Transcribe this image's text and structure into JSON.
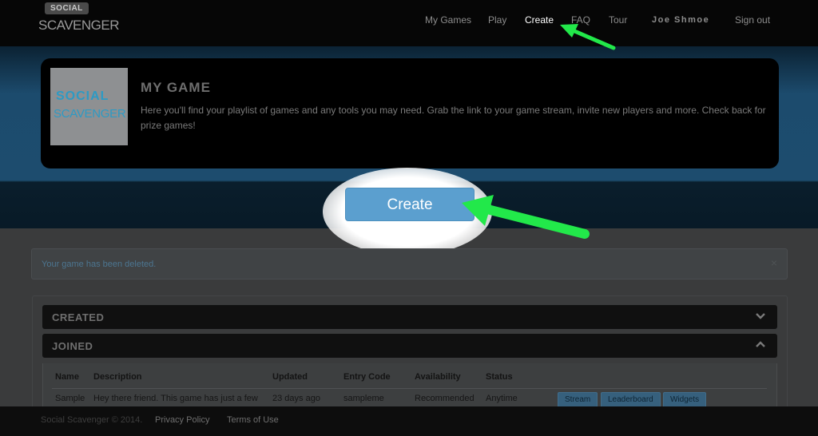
{
  "brand": {
    "badge": "SOCIAL",
    "wordmark": "SCAVENGER"
  },
  "nav": {
    "my_games": "My Games",
    "play": "Play",
    "create": "Create",
    "faq": "FAQ",
    "tour": "Tour",
    "user": "Joe Shmoe",
    "sign_out": "Sign out"
  },
  "hero": {
    "thumb_line1": "SOCIAL",
    "thumb_line2": "SCAVENGER",
    "title": "MY GAME",
    "description": "Here you'll find your playlist of games and any tools you may need. Grab the link to your game stream, invite new players and more. Check back for prize games!"
  },
  "create_button": "Create",
  "alert": {
    "message": "Your game has been deleted.",
    "close": "×"
  },
  "sections": {
    "created": {
      "label": "CREATED",
      "icon": "chevron-down-icon"
    },
    "joined": {
      "label": "JOINED",
      "icon": "chevron-up-icon"
    }
  },
  "table": {
    "headers": [
      "Name",
      "Description",
      "Updated",
      "Entry Code",
      "Availability",
      "Status"
    ],
    "rows": [
      {
        "name": "Sample",
        "description": "Hey there friend. This game has just a few",
        "updated": "23 days ago",
        "entry_code": "sampleme",
        "availability": "Recommended",
        "status": "Anytime",
        "actions": [
          "Stream",
          "Leaderboard",
          "Widgets"
        ]
      }
    ]
  },
  "footer": {
    "copyright": "Social Scavenger © 2014.",
    "privacy": "Privacy Policy",
    "terms": "Terms of Use"
  },
  "colors": {
    "accent": "#5b9fcf",
    "arrow": "#22e84a",
    "band": "#1d4c6e"
  }
}
